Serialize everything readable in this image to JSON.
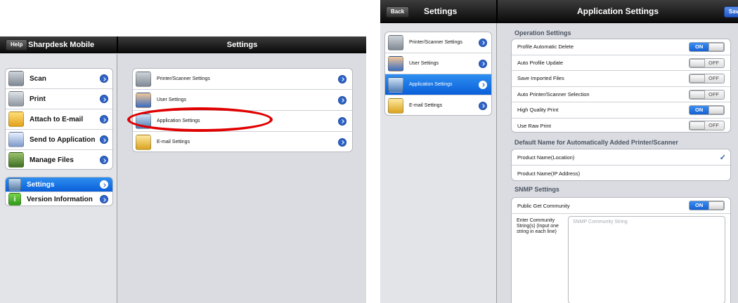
{
  "left_screen": {
    "nav": {
      "help_button": "Help",
      "app_title": "Sharpdesk Mobile",
      "detail_title": "Settings"
    },
    "menu_main": [
      {
        "label": "Scan",
        "icon": "scanner-icon"
      },
      {
        "label": "Print",
        "icon": "printer-icon"
      },
      {
        "label": "Attach to E-mail",
        "icon": "email-icon"
      },
      {
        "label": "Send to Application",
        "icon": "application-icon"
      },
      {
        "label": "Manage Files",
        "icon": "files-icon"
      }
    ],
    "menu_secondary": [
      {
        "label": "Settings",
        "icon": "gear-icon",
        "selected": true
      },
      {
        "label": "Version Information",
        "icon": "info-icon"
      }
    ],
    "settings_list": [
      {
        "label": "Printer/Scanner Settings",
        "icon": "printer-scanner-icon"
      },
      {
        "label": "User Settings",
        "icon": "user-icon"
      },
      {
        "label": "Application Settings",
        "icon": "application-settings-icon"
      },
      {
        "label": "E-mail Settings",
        "icon": "email-settings-icon"
      }
    ],
    "info_icon_glyph": "i",
    "highlight_color": "#e00000"
  },
  "right_screen": {
    "nav": {
      "back_button": "Back",
      "left_title": "Settings",
      "detail_title": "Application Settings",
      "save_button": "Sav"
    },
    "settings_list": [
      {
        "label": "Printer/Scanner Settings",
        "icon": "printer-scanner-icon"
      },
      {
        "label": "User Settings",
        "icon": "user-icon"
      },
      {
        "label": "Application Settings",
        "icon": "application-settings-icon",
        "selected": true
      },
      {
        "label": "E-mail Settings",
        "icon": "email-settings-icon"
      }
    ],
    "operation": {
      "title": "Operation Settings",
      "rows": [
        {
          "label": "Profile Automatic Delete",
          "state": "ON"
        },
        {
          "label": "Auto Profile Update",
          "state": "OFF"
        },
        {
          "label": "Save Imported Files",
          "state": "OFF"
        },
        {
          "label": "Auto Printer/Scanner Selection",
          "state": "OFF"
        },
        {
          "label": "High Quality Print",
          "state": "ON"
        },
        {
          "label": "Use Raw Print",
          "state": "OFF"
        }
      ]
    },
    "default_name": {
      "title": "Default Name for Automatically Added Printer/Scanner",
      "rows": [
        {
          "label": "Product Name(Location)",
          "checked": true
        },
        {
          "label": "Product Name(IP Address)",
          "checked": false
        }
      ],
      "check_glyph": "✓"
    },
    "snmp": {
      "title": "SNMP Settings",
      "public_get": {
        "label": "Public Get Community",
        "state": "ON"
      },
      "community_label": "Enter Community String(s) (Input one string in each line)",
      "community_placeholder": "SNMP Community String"
    },
    "accent_color": "#1760d2"
  }
}
